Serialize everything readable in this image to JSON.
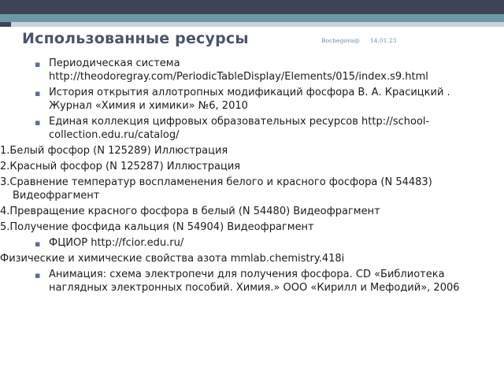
{
  "slide": {
    "title": "Использованные ресурсы",
    "author": "Bochegova@",
    "date": "14.01.23"
  },
  "items": [
    {
      "type": "bullet",
      "text": "Периодическая система http://theodoregray.com/PeriodicTableDisplay/Elements/015/index.s9.html"
    },
    {
      "type": "bullet",
      "text": "История открытия аллотропных модификаций фосфора В. А. Красицкий . Журнал «Химия и химики» №6, 2010"
    },
    {
      "type": "bullet",
      "text": "Единая коллекция цифровых образовательных ресурсов http://school-collection.edu.ru/catalog/"
    },
    {
      "type": "num",
      "text": "1.Белый фосфор (N 125289) Иллюстрация"
    },
    {
      "type": "num",
      "text": "2.Красный фосфор (N 125287) Иллюстрация"
    },
    {
      "type": "num",
      "text": "3.Сравнение температур воспламенения белого и красного фосфора (N 54483) Видеофрагмент"
    },
    {
      "type": "num",
      "text": "4.Превращение красного фосфора в белый (N 54480) Видеофрагмент"
    },
    {
      "type": "num",
      "text": "5.Получение фосфида кальция (N 54904) Видеофрагмент"
    },
    {
      "type": "bullet",
      "text": "ФЦИОР http://fcior.edu.ru/"
    },
    {
      "type": "plain",
      "text": "Физические и химические свойства азота mmlab.chemistry.418i"
    },
    {
      "type": "bullet",
      "text": "Анимация: схема электропечи для получения фосфора. CD «Библиотека наглядных электронных пособий. Химия.» ООО «Кирилл и Мефодий», 2006"
    }
  ],
  "icons": {
    "bullet": "square-bullet-icon"
  },
  "colors": {
    "header_dark": "#3d4456",
    "header_teal": "#6b9aa6",
    "title": "#4b5468",
    "bullet": "#5a6e9a"
  }
}
